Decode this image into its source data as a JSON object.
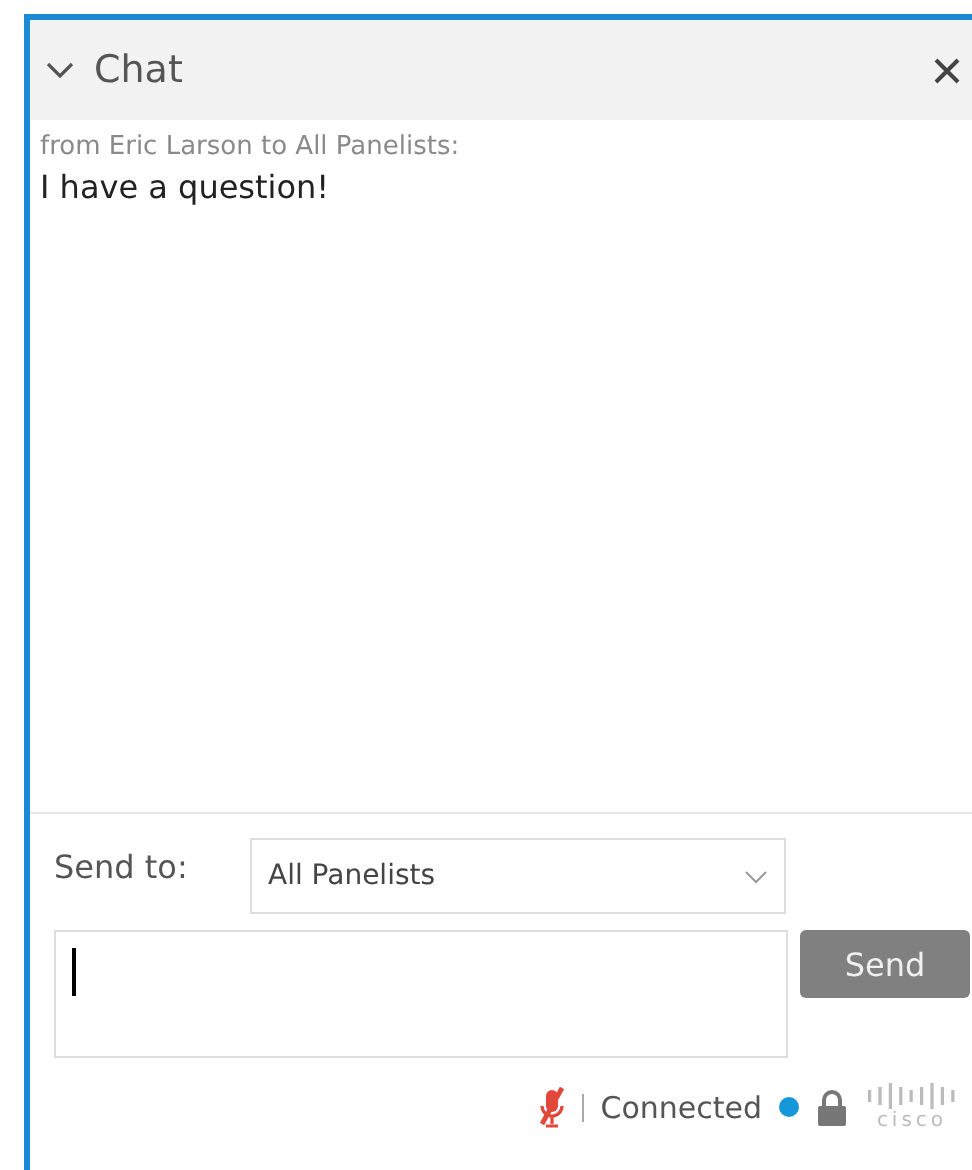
{
  "panel": {
    "title": "Chat",
    "expanded": true
  },
  "messages": [
    {
      "sender": "from Eric Larson to All Panelists:",
      "text": "I have a question!"
    }
  ],
  "send_to": {
    "label": "Send to:",
    "value": "All Panelists"
  },
  "composer": {
    "button": "Send",
    "button_disabled": true
  },
  "status_bar": {
    "mic_muted": true,
    "status": "Connected",
    "logo_text": "cisco"
  }
}
